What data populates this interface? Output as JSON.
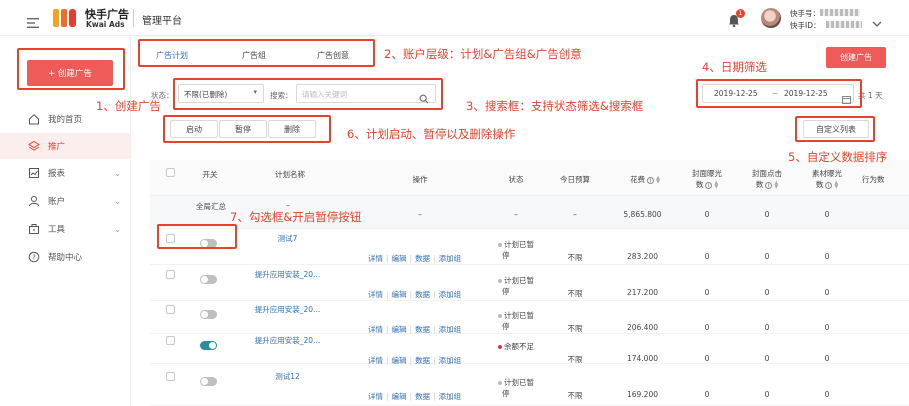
{
  "brand": {
    "cn": "快手广告",
    "en": "Kwai Ads",
    "platform": "管理平台"
  },
  "header": {
    "badge_count": "1",
    "account_prefix": "快手号：",
    "account_id_prefix": "快手ID："
  },
  "sidebar": {
    "create_button": "+ 创建广告",
    "items": [
      {
        "label": "我的首页",
        "icon": "home-icon"
      },
      {
        "label": "推广",
        "icon": "layers-icon"
      },
      {
        "label": "报表",
        "icon": "chart-icon"
      },
      {
        "label": "账户",
        "icon": "user-icon"
      },
      {
        "label": "工具",
        "icon": "toolbox-icon"
      },
      {
        "label": "帮助中心",
        "icon": "help-icon"
      }
    ]
  },
  "tabs": [
    "广告计划",
    "广告组",
    "广告创意"
  ],
  "create_ad_button": "创建广告",
  "filter": {
    "status_label": "状态：",
    "status_value": "不限(已删除)",
    "search_label": "搜索：",
    "search_placeholder": "请输入关键词"
  },
  "date": {
    "start": "2019-12-25",
    "sep": "~",
    "end": "2019-12-25",
    "suffix": "共 1 天"
  },
  "actions": [
    "启动",
    "暂停",
    "删除"
  ],
  "custom_columns_button": "自定义列表",
  "table": {
    "headers": {
      "switch": "开关",
      "name": "计划名称",
      "ops": "操作",
      "status": "状态",
      "budget": "今日预算",
      "cost": "花费",
      "impressions": [
        "封面曝光",
        "数"
      ],
      "clicks": [
        "封面点击",
        "数"
      ],
      "material": [
        "素材曝光",
        "数"
      ],
      "behavior": "行为数"
    },
    "summary": {
      "label": "全局汇总",
      "dash1": "–",
      "ops": "–",
      "status": "–",
      "budget": "–",
      "cost": "5,865.800",
      "impressions": "0",
      "clicks": "0",
      "material": "0"
    },
    "op_labels": [
      "详情",
      "编辑",
      "数据",
      "添加组"
    ],
    "rows": [
      {
        "name": "测试7",
        "status": [
          "计划已暂",
          "停"
        ],
        "budget": "不限",
        "cost": "283.200",
        "impressions": "0",
        "clicks": "0",
        "material": "0",
        "on": false
      },
      {
        "name": "提升应用安装_20...",
        "status": [
          "计划已暂",
          "停"
        ],
        "budget": "不限",
        "cost": "217.200",
        "impressions": "0",
        "clicks": "0",
        "material": "0",
        "on": false
      },
      {
        "name": "提升应用安装_20...",
        "status": [
          "计划已暂",
          "停"
        ],
        "budget": "不限",
        "cost": "206.400",
        "impressions": "0",
        "clicks": "0",
        "material": "0",
        "on": false
      },
      {
        "name": "提升应用安装_20...",
        "status": [
          "余额不足",
          ""
        ],
        "budget": "不限",
        "cost": "174.000",
        "impressions": "0",
        "clicks": "0",
        "material": "0",
        "on": true
      },
      {
        "name": "测试12",
        "status": [
          "计划已暂",
          "停"
        ],
        "budget": "不限",
        "cost": "169.200",
        "impressions": "0",
        "clicks": "0",
        "material": "0",
        "on": false
      }
    ]
  },
  "annotations": [
    "1、创建广告",
    "2、账户层级：计划&广告组&广告创意",
    "3、搜索框：支持状态筛选&搜索框",
    "4、日期筛选",
    "5、自定义数据排序",
    "6、计划启动、暂停以及删除操作",
    "7、勾选框&开启暂停按钮"
  ],
  "colors": {
    "brand_red": "#f05a58",
    "annotation_red": "#e8412d",
    "link_blue": "#2f6fb3",
    "toggle_on": "#2a8c9c"
  }
}
